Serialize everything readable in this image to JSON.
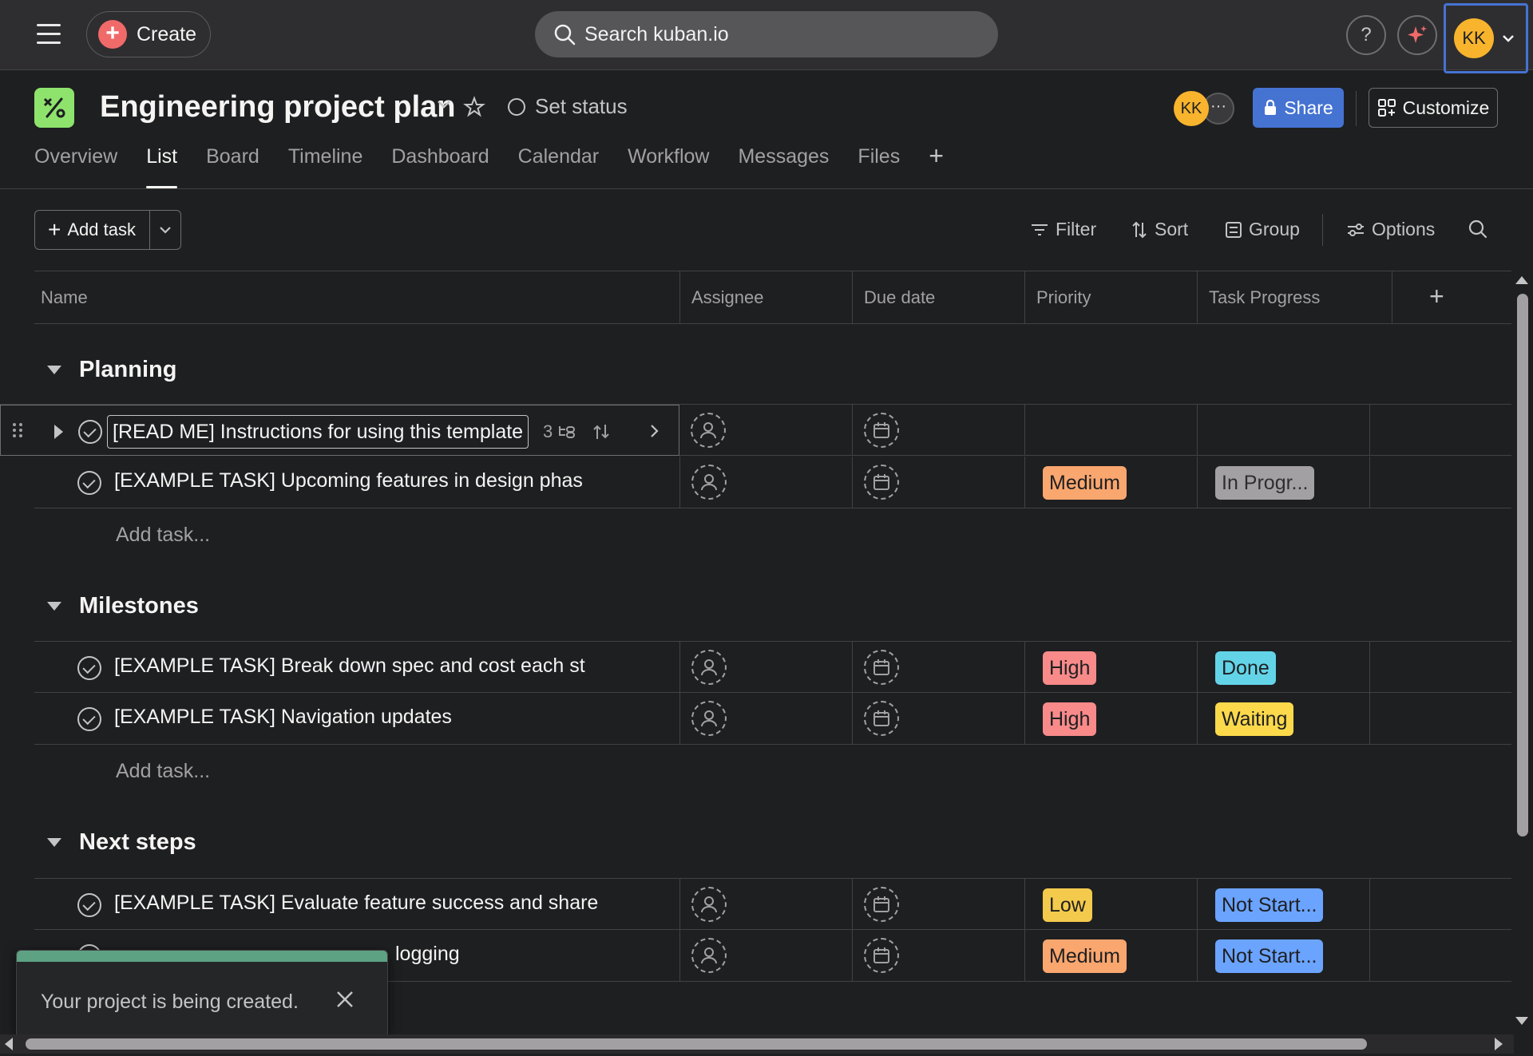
{
  "topbar": {
    "create_label": "Create",
    "search_placeholder": "Search kuban.io",
    "help_label": "?",
    "user_initials": "KK"
  },
  "project": {
    "title": "Engineering project plan",
    "set_status_label": "Set status",
    "member_initials": "KK",
    "members_more": "···",
    "share_label": "Share",
    "customize_label": "Customize"
  },
  "tabs": [
    {
      "label": "Overview"
    },
    {
      "label": "List",
      "active": true
    },
    {
      "label": "Board"
    },
    {
      "label": "Timeline"
    },
    {
      "label": "Dashboard"
    },
    {
      "label": "Calendar"
    },
    {
      "label": "Workflow"
    },
    {
      "label": "Messages"
    },
    {
      "label": "Files"
    }
  ],
  "toolbar": {
    "add_task_label": "Add task",
    "filter_label": "Filter",
    "sort_label": "Sort",
    "group_label": "Group",
    "options_label": "Options"
  },
  "columns": {
    "name": "Name",
    "assignee": "Assignee",
    "due_date": "Due date",
    "priority": "Priority",
    "progress": "Task Progress",
    "add": "+"
  },
  "add_task_placeholder": "Add task...",
  "sections": [
    {
      "title": "Planning",
      "tasks": [
        {
          "name": "[READ ME] Instructions for using this template",
          "subtasks": "3",
          "priority": "",
          "progress": ""
        },
        {
          "name": "[EXAMPLE TASK] Upcoming features in design phas",
          "priority": "Medium",
          "progress": "In Progr..."
        }
      ]
    },
    {
      "title": "Milestones",
      "tasks": [
        {
          "name": "[EXAMPLE TASK] Break down spec and cost each st",
          "priority": "High",
          "progress": "Done"
        },
        {
          "name": "[EXAMPLE TASK] Navigation updates",
          "priority": "High",
          "progress": "Waiting"
        }
      ]
    },
    {
      "title": "Next steps",
      "tasks": [
        {
          "name": "[EXAMPLE TASK] Evaluate feature success and share",
          "priority": "Low",
          "progress": "Not Start..."
        },
        {
          "name": "logging",
          "priority": "Medium",
          "progress": "Not Start..."
        }
      ]
    }
  ],
  "colors": {
    "medium": "#f9a66f",
    "high": "#f88a8a",
    "low": "#f4ca4c",
    "in_progress": "#a2a0a2",
    "done": "#63d4e8",
    "waiting": "#fcd94b",
    "not_started": "#6ba4ff",
    "accent": "#4573d2"
  },
  "toast": {
    "message": "Your project is being created."
  }
}
